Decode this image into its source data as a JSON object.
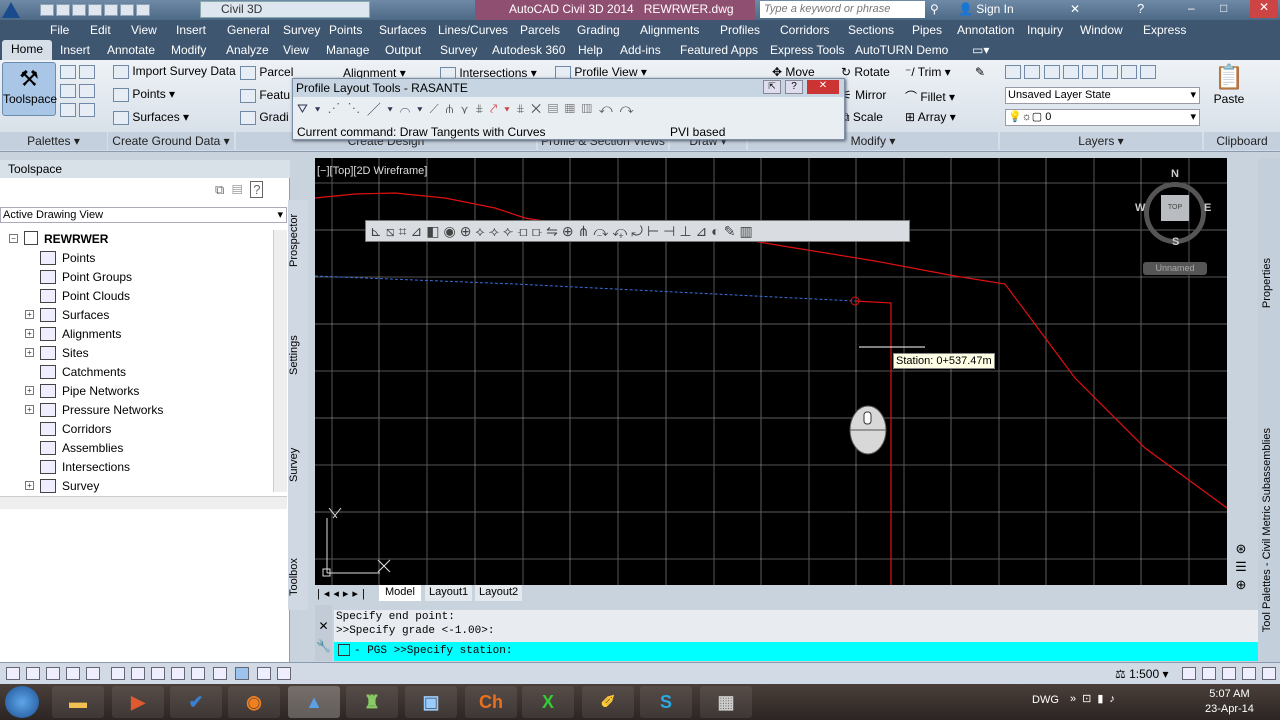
{
  "titlebar": {
    "workspace": "Civil 3D",
    "app_title": "AutoCAD Civil 3D 2014",
    "file_name": "REWRWER.dwg",
    "search_placeholder": "Type a keyword or phrase",
    "sign_in": "Sign In"
  },
  "menubar": [
    "File",
    "Edit",
    "View",
    "Insert",
    "General",
    "Survey",
    "Points",
    "Surfaces",
    "Lines/Curves",
    "Parcels",
    "Grading",
    "Alignments",
    "Profiles",
    "Corridors",
    "Sections",
    "Pipes",
    "Annotation",
    "Inquiry",
    "Window",
    "Express"
  ],
  "ribbon_tabs": [
    "Home",
    "Insert",
    "Annotate",
    "Modify",
    "Analyze",
    "View",
    "Manage",
    "Output",
    "Survey",
    "Autodesk 360",
    "Help",
    "Add-ins",
    "Featured Apps",
    "Express Tools",
    "AutoTURN Demo"
  ],
  "ribbon": {
    "toolspace": "Toolspace",
    "palettes": "Palettes",
    "import_survey": "Import Survey Data",
    "points": "Points",
    "surfaces": "Surfaces",
    "create_ground": "Create Ground Data",
    "parcel": "Parcel",
    "feature": "Featu",
    "grading": "Gradi",
    "alignment": "Alignment",
    "intersections": "Intersections",
    "profile_view": "Profile View",
    "create_design": "Create Design",
    "profile_section": "Profile & Section Views",
    "draw": "Draw",
    "move": "Move",
    "rotate": "Rotate",
    "trim": "Trim",
    "mirror": "Mirror",
    "fillet": "Fillet",
    "scale": "Scale",
    "array": "Array",
    "modify": "Modify",
    "layer_state": "Unsaved Layer State",
    "layer_value": "0",
    "layers": "Layers",
    "paste": "Paste",
    "clipboard": "Clipboard"
  },
  "profile_tools": {
    "title": "Profile Layout Tools - RASANTE",
    "current_command": "Current command: Draw Tangents with Curves",
    "mode": "PVI based"
  },
  "toolspace": {
    "header": "Toolspace",
    "view": "Active Drawing View",
    "root": "REWRWER",
    "items": [
      "Points",
      "Point Groups",
      "Point Clouds",
      "Surfaces",
      "Alignments",
      "Sites",
      "Catchments",
      "Pipe Networks",
      "Pressure Networks",
      "Corridors",
      "Assemblies",
      "Intersections",
      "Survey"
    ],
    "tabs": [
      "Prospector",
      "Settings",
      "Survey",
      "Toolbox"
    ]
  },
  "viewport": {
    "label": "[−][Top][2D Wireframe]",
    "station": "Station: 0+537.47m",
    "compass": {
      "n": "N",
      "s": "S",
      "e": "E",
      "w": "W",
      "top": "TOP"
    },
    "ucs": "Unnamed"
  },
  "layout_tabs": [
    "Model",
    "Layout1",
    "Layout2"
  ],
  "command": {
    "line1": "Specify end point:",
    "line2": ">>Specify grade <-1.00>:",
    "prompt": "- PGS >>Specify station:"
  },
  "status": {
    "scale": "1:500"
  },
  "right_panel": [
    "Properties",
    "Tool Palettes - Civil Metric Subassemblies"
  ],
  "taskbar": {
    "tray": "DWG",
    "time": "5:07 AM",
    "date": "23-Apr-14"
  }
}
